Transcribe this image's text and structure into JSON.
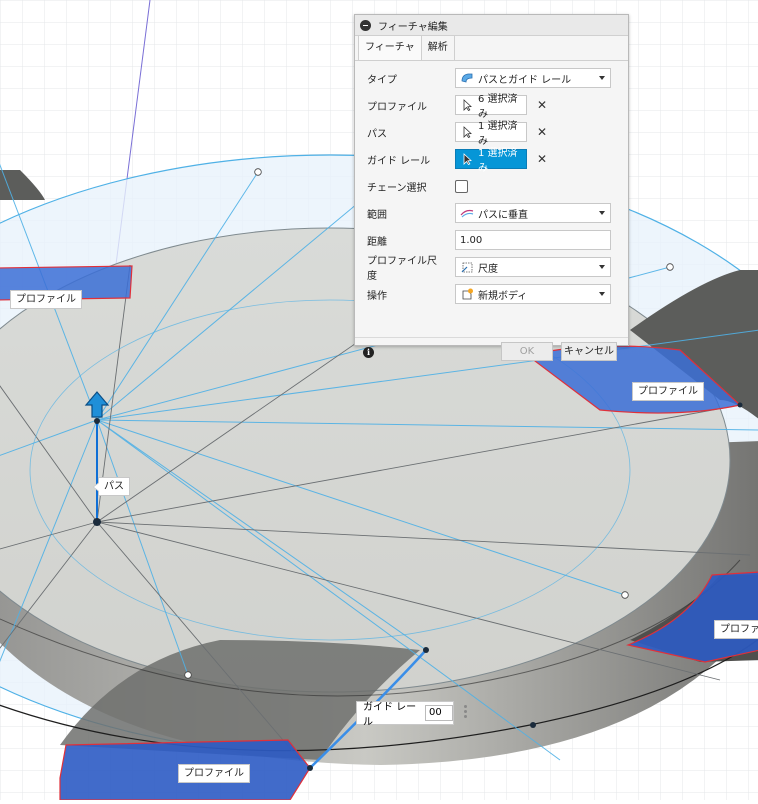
{
  "canvas": {
    "labels": {
      "profile_top_left": "プロファイル",
      "profile_right": "プロファイル",
      "profile_lower_right": "プロファイル",
      "profile_bottom": "プロファイル",
      "path": "パス"
    },
    "guide_rail_input": {
      "label": "ガイド レール",
      "value": "00"
    }
  },
  "dialog": {
    "title": "フィーチャ編集",
    "tabs": [
      "フィーチャ",
      "解析"
    ],
    "fields": {
      "type": {
        "label": "タイプ",
        "value": "パスとガイド レール"
      },
      "profile": {
        "label": "プロファイル",
        "value": "6 選択済み"
      },
      "path": {
        "label": "パス",
        "value": "1 選択済み"
      },
      "guide_rail": {
        "label": "ガイド レール",
        "value": "1 選択済み"
      },
      "chain_select": {
        "label": "チェーン選択",
        "checked": false
      },
      "extent": {
        "label": "範囲",
        "value": "パスに垂直"
      },
      "distance": {
        "label": "距離",
        "value": "1.00"
      },
      "profile_scaling": {
        "label": "プロファイル尺度",
        "value": "尺度"
      },
      "operation": {
        "label": "操作",
        "value": "新規ボディ"
      }
    },
    "ok_label": "OK",
    "cancel_label": "キャンセル"
  },
  "colors": {
    "accent": "#0696d7",
    "profile_fill": "#3b6fd6",
    "profile_edge": "#e0303a",
    "sketch_line": "#4fb1e6"
  }
}
